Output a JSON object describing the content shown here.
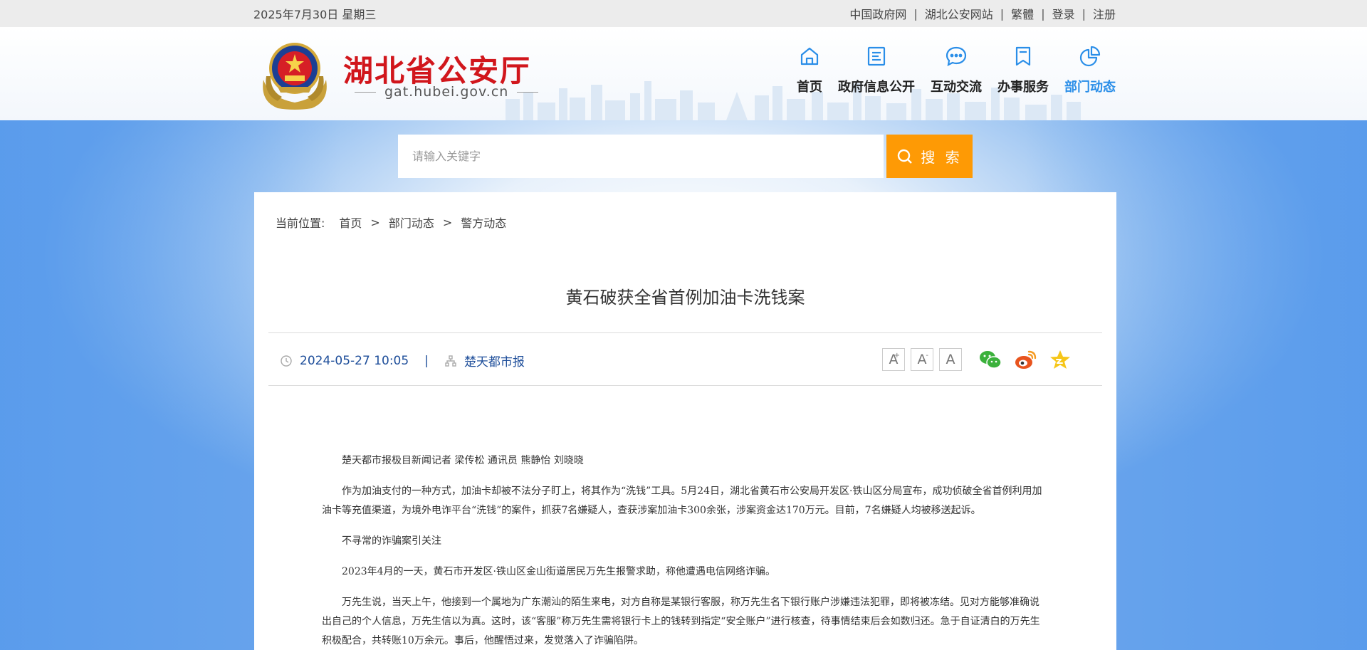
{
  "topbar": {
    "date": "2025年7月30日 星期三",
    "links": [
      "中国政府网",
      "湖北公安网站",
      "繁體",
      "登录",
      "注册"
    ],
    "separator": "|"
  },
  "header": {
    "site_name": "湖北省公安厅",
    "domain": "gat.hubei.gov.cn",
    "nav": [
      {
        "label": "首页",
        "icon": "home-icon"
      },
      {
        "label": "政府信息公开",
        "icon": "document-icon"
      },
      {
        "label": "互动交流",
        "icon": "chat-bubble-icon"
      },
      {
        "label": "办事服务",
        "icon": "bookmark-icon"
      },
      {
        "label": "部门动态",
        "icon": "pie-chart-icon",
        "active": true
      }
    ],
    "accent_color": "#2a8ee8",
    "brand_color": "#d1161c"
  },
  "search": {
    "placeholder": "请输入关键字",
    "button_label": "搜 索",
    "button_color": "#fe9a05"
  },
  "breadcrumb": {
    "lead": "当前位置:",
    "items": [
      "首页",
      "部门动态",
      "警方动态"
    ],
    "separator": ">"
  },
  "article": {
    "title": "黄石破获全省首例加油卡洗钱案",
    "date": "2024-05-27 10:05",
    "divider": "|",
    "source": "楚天都市报",
    "font_buttons": [
      "A",
      "A",
      "A"
    ],
    "font_button_marks": [
      "+",
      "-"
    ],
    "share_icons": [
      "wechat-icon",
      "weibo-icon",
      "favorite-star-icon"
    ],
    "paragraphs": [
      "楚天都市报极目新闻记者 梁传松 通讯员 熊静怡 刘晓晓",
      "作为加油支付的一种方式，加油卡却被不法分子盯上，将其作为“洗钱”工具。5月24日，湖北省黄石市公安局开发区·铁山区分局宣布，成功侦破全省首例利用加油卡等充值渠道，为境外电诈平台“洗钱”的案件，抓获7名嫌疑人，查获涉案加油卡300余张，涉案资金达170万元。目前，7名嫌疑人均被移送起诉。",
      "不寻常的诈骗案引关注",
      "2023年4月的一天，黄石市开发区·铁山区金山街道居民万先生报警求助，称他遭遇电信网络诈骗。",
      "万先生说，当天上午，他接到一个属地为广东潮汕的陌生来电，对方自称是某银行客服，称万先生名下银行账户涉嫌违法犯罪，即将被冻结。见对方能够准确说出自己的个人信息，万先生信以为真。这时，该“客服”称万先生需将银行卡上的钱转到指定“安全账户”进行核查，待事情结束后会如数归还。急于自证清白的万先生积极配合，共转账10万余元。事后，他醒悟过来，发觉落入了诈骗陷阱。"
    ]
  }
}
